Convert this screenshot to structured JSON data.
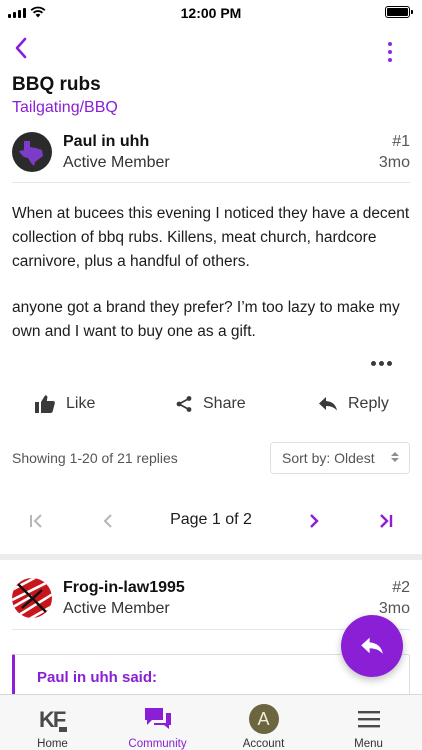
{
  "status_bar": {
    "time": "12:00 PM"
  },
  "nav": {
    "back_icon": "chevron-left-icon",
    "menu_icon": "kebab-icon",
    "accent_color": "#8a1fd6"
  },
  "thread": {
    "title": "BBQ rubs",
    "forum": "Tailgating/BBQ"
  },
  "post": {
    "author": "Paul in uhh",
    "role": "Active Member",
    "number": "#1",
    "age": "3mo",
    "paragraphs": [
      "When at bucees this evening I noticed they have a decent collection of bbq rubs. Killens, meat church, hardcore carnivore, plus a handful of others.",
      "anyone got a brand they prefer? I’m too lazy to make my own and I want to buy one as a gift."
    ]
  },
  "actions": {
    "like": "Like",
    "share": "Share",
    "reply": "Reply"
  },
  "replies": {
    "info": "Showing 1-20 of 21 replies",
    "sort": "Sort by: Oldest"
  },
  "pagination": {
    "label": "Page 1 of 2",
    "current": 1,
    "total": 2
  },
  "post2": {
    "author": "Frog-in-law1995",
    "role": "Active Member",
    "number": "#2",
    "age": "3mo",
    "quote_author": "Paul in uhh said:"
  },
  "tabbar": {
    "home": "Home",
    "community": "Community",
    "account": "Account",
    "menu": "Menu",
    "account_initial": "A",
    "home_logo": "KF"
  }
}
